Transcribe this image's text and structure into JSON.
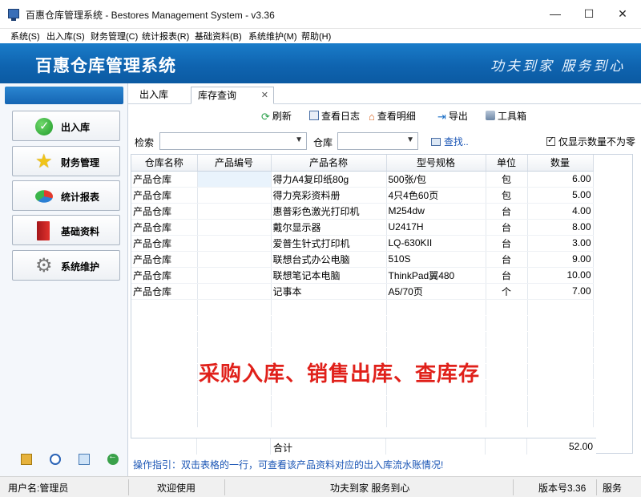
{
  "window": {
    "title": "百惠仓库管理系统 - Bestores Management System - v3.36",
    "minimize": "—",
    "maximize": "☐",
    "close": "✕"
  },
  "menu": [
    "系统(S)",
    "出入库(S)",
    "财务管理(C)",
    "统计报表(R)",
    "基础资料(B)",
    "系统维护(M)",
    "帮助(H)"
  ],
  "banner": {
    "brand": "百惠仓库管理系统",
    "slogan": "功夫到家 服务到心",
    "color": "#0f64b0"
  },
  "sidebar": {
    "items": [
      {
        "label": "出入库",
        "icon": "check-circle-icon"
      },
      {
        "label": "财务管理",
        "icon": "star-icon"
      },
      {
        "label": "统计报表",
        "icon": "pie-chart-icon"
      },
      {
        "label": "基础资料",
        "icon": "book-icon"
      },
      {
        "label": "系统维护",
        "icon": "gear-icon"
      }
    ],
    "tools": [
      "key-icon",
      "info-icon",
      "search-window-icon",
      "back-arrow-icon"
    ]
  },
  "tabs": [
    {
      "label": "出入库"
    },
    {
      "label": "库存查询",
      "active": true
    }
  ],
  "toolbar": {
    "refresh": "刷新",
    "log": "查看日志",
    "detail": "查看明细",
    "export": "导出",
    "tools": "工具箱"
  },
  "filters": {
    "search_label": "检索",
    "warehouse_label": "仓库",
    "find": "查找..",
    "only_show_nonzero": "仅显示数量不为零"
  },
  "table": {
    "headers": [
      "仓库名称",
      "产品编号",
      "产品名称",
      "型号规格",
      "单位",
      "数量"
    ],
    "rows": [
      [
        "产品仓库",
        "",
        "得力A4复印纸80g",
        "500张/包",
        "包",
        "6.00"
      ],
      [
        "产品仓库",
        "",
        "得力亮彩资料册",
        "4只4色60页",
        "包",
        "5.00"
      ],
      [
        "产品仓库",
        "",
        "惠普彩色激光打印机",
        "M254dw",
        "台",
        "4.00"
      ],
      [
        "产品仓库",
        "",
        "戴尔显示器",
        "U2417H",
        "台",
        "8.00"
      ],
      [
        "产品仓库",
        "",
        "爱普生针式打印机",
        "LQ-630KII",
        "台",
        "3.00"
      ],
      [
        "产品仓库",
        "",
        "联想台式办公电脑",
        "510S",
        "台",
        "9.00"
      ],
      [
        "产品仓库",
        "",
        "联想笔记本电脑",
        "ThinkPad翼480",
        "台",
        "10.00"
      ],
      [
        "产品仓库",
        "",
        "记事本",
        "A5/70页",
        "个",
        "7.00"
      ]
    ],
    "total_label": "合计",
    "total_value": "52.00"
  },
  "watermark": "采购入库、销售出库、查库存",
  "hint": "操作指引：双击表格的一行，可查看该产品资料对应的出入库流水账情况!",
  "status": {
    "user": "用户名:管理员",
    "welcome": "欢迎使用",
    "motto": "功夫到家 服务到心",
    "version": "版本号3.36",
    "extra": "服务"
  }
}
